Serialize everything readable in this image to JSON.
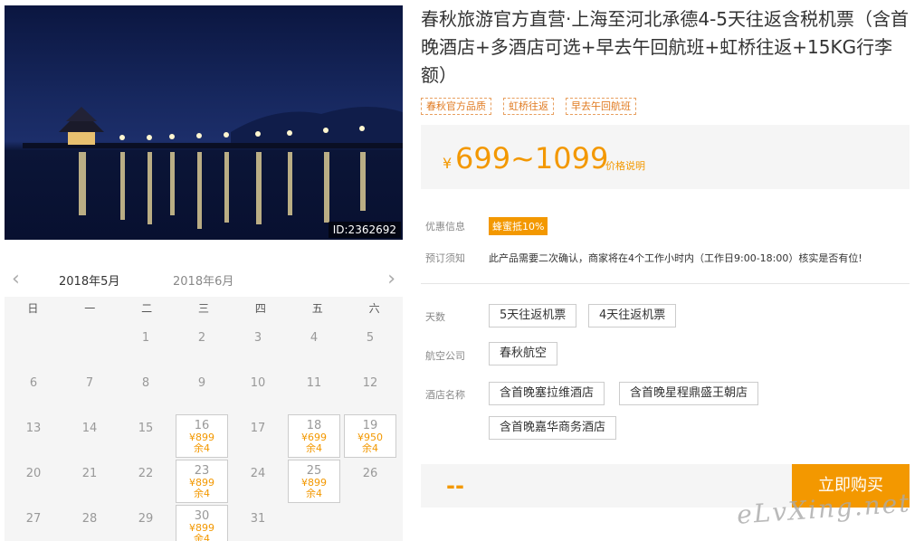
{
  "photo": {
    "id_label": "ID:2362692"
  },
  "calendar": {
    "prev_arrow": "‹",
    "next_arrow": "›",
    "months": [
      "2018年5月",
      "2018年6月"
    ],
    "weekdays": [
      "日",
      "一",
      "二",
      "三",
      "四",
      "五",
      "六"
    ],
    "days": [
      {
        "d": "1",
        "col": 2,
        "row": 0
      },
      {
        "d": "2",
        "col": 3,
        "row": 0
      },
      {
        "d": "3",
        "col": 4,
        "row": 0
      },
      {
        "d": "4",
        "col": 5,
        "row": 0
      },
      {
        "d": "5",
        "col": 6,
        "row": 0
      },
      {
        "d": "6",
        "col": 0,
        "row": 1
      },
      {
        "d": "7",
        "col": 1,
        "row": 1
      },
      {
        "d": "8",
        "col": 2,
        "row": 1
      },
      {
        "d": "9",
        "col": 3,
        "row": 1
      },
      {
        "d": "10",
        "col": 4,
        "row": 1
      },
      {
        "d": "11",
        "col": 5,
        "row": 1
      },
      {
        "d": "12",
        "col": 6,
        "row": 1
      },
      {
        "d": "13",
        "col": 0,
        "row": 2
      },
      {
        "d": "14",
        "col": 1,
        "row": 2
      },
      {
        "d": "15",
        "col": 2,
        "row": 2
      },
      {
        "d": "16",
        "col": 3,
        "row": 2,
        "price": "¥899",
        "stock": "余4"
      },
      {
        "d": "17",
        "col": 4,
        "row": 2
      },
      {
        "d": "18",
        "col": 5,
        "row": 2,
        "price": "¥699",
        "stock": "余4"
      },
      {
        "d": "19",
        "col": 6,
        "row": 2,
        "price": "¥950",
        "stock": "余4"
      },
      {
        "d": "20",
        "col": 0,
        "row": 3
      },
      {
        "d": "21",
        "col": 1,
        "row": 3
      },
      {
        "d": "22",
        "col": 2,
        "row": 3
      },
      {
        "d": "23",
        "col": 3,
        "row": 3,
        "price": "¥899",
        "stock": "余4"
      },
      {
        "d": "24",
        "col": 4,
        "row": 3
      },
      {
        "d": "25",
        "col": 5,
        "row": 3,
        "price": "¥899",
        "stock": "余4"
      },
      {
        "d": "26",
        "col": 6,
        "row": 3
      },
      {
        "d": "27",
        "col": 0,
        "row": 4
      },
      {
        "d": "28",
        "col": 1,
        "row": 4
      },
      {
        "d": "29",
        "col": 2,
        "row": 4
      },
      {
        "d": "30",
        "col": 3,
        "row": 4,
        "price": "¥899",
        "stock": "余4"
      },
      {
        "d": "31",
        "col": 4,
        "row": 4
      }
    ]
  },
  "product": {
    "title": "春秋旅游官方直营·上海至河北承德4-5天往返含税机票（含首晚酒店+多酒店可选+早去午回航班+虹桥往返+15KG行李额）",
    "tags": [
      "春秋官方品质",
      "虹桥往返",
      "早去午回航班"
    ],
    "price_currency": "¥",
    "price_range": "699~1099",
    "price_note": "价格说明"
  },
  "info": {
    "discount_label": "优惠信息",
    "discount_badge": "蜂蜜抵10%",
    "notice_label": "预订须知",
    "notice_text": "此产品需要二次确认，商家将在4个工作小时内（工作日9:00-18:00）核实是否有位!"
  },
  "options": {
    "days_label": "天数",
    "days": [
      "5天往返机票",
      "4天往返机票"
    ],
    "airline_label": "航空公司",
    "airlines": [
      "春秋航空"
    ],
    "hotel_label": "酒店名称",
    "hotels": [
      "含首晚塞拉维酒店",
      "含首晚星程鼎盛王朝店",
      "含首晚嘉华商务酒店"
    ]
  },
  "buy": {
    "total": "--",
    "button": "立即购买"
  },
  "watermark": "eLvXing.net",
  "colors": {
    "accent": "#f39800"
  }
}
